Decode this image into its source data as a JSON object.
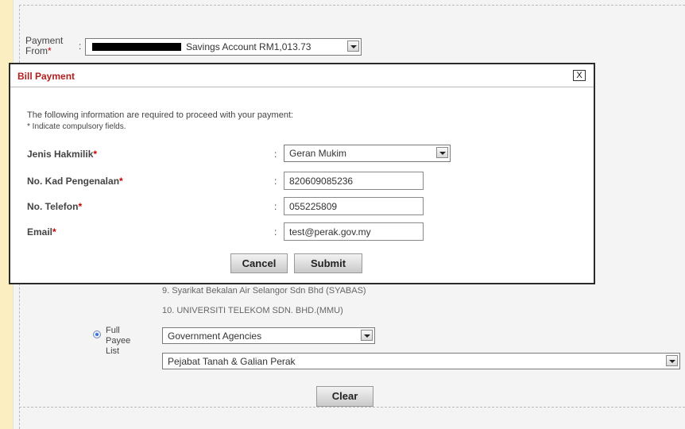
{
  "payment_from": {
    "label": "Payment From",
    "required_mark": "*",
    "colon": ":",
    "account_text": "Savings Account RM1,013.73"
  },
  "modal": {
    "title": "Bill Payment",
    "close_label": "X",
    "intro": "The following information are required to proceed with your payment:",
    "note": "* Indicate compulsory fields.",
    "fields": [
      {
        "label": "Jenis Hakmilik",
        "required": "*",
        "colon": ":",
        "value": "Geran Mukim"
      },
      {
        "label": "No. Kad Pengenalan",
        "required": "*",
        "colon": ":",
        "value": "820609085236"
      },
      {
        "label": "No. Telefon",
        "required": "*",
        "colon": ":",
        "value": "055225809"
      },
      {
        "label": "Email",
        "required": "*",
        "colon": ":",
        "value": "test@perak.gov.my"
      }
    ],
    "cancel_label": "Cancel",
    "submit_label": "Submit"
  },
  "payee_list": {
    "items": [
      "9. Syarikat Bekalan Air Selangor Sdn Bhd (SYABAS)",
      "10. UNIVERSITI TELEKOM SDN. BHD.(MMU)"
    ]
  },
  "full_payee": {
    "label": "Full Payee List",
    "category_value": "Government Agencies",
    "payee_value": "Pejabat Tanah & Galian Perak"
  },
  "clear_label": "Clear"
}
